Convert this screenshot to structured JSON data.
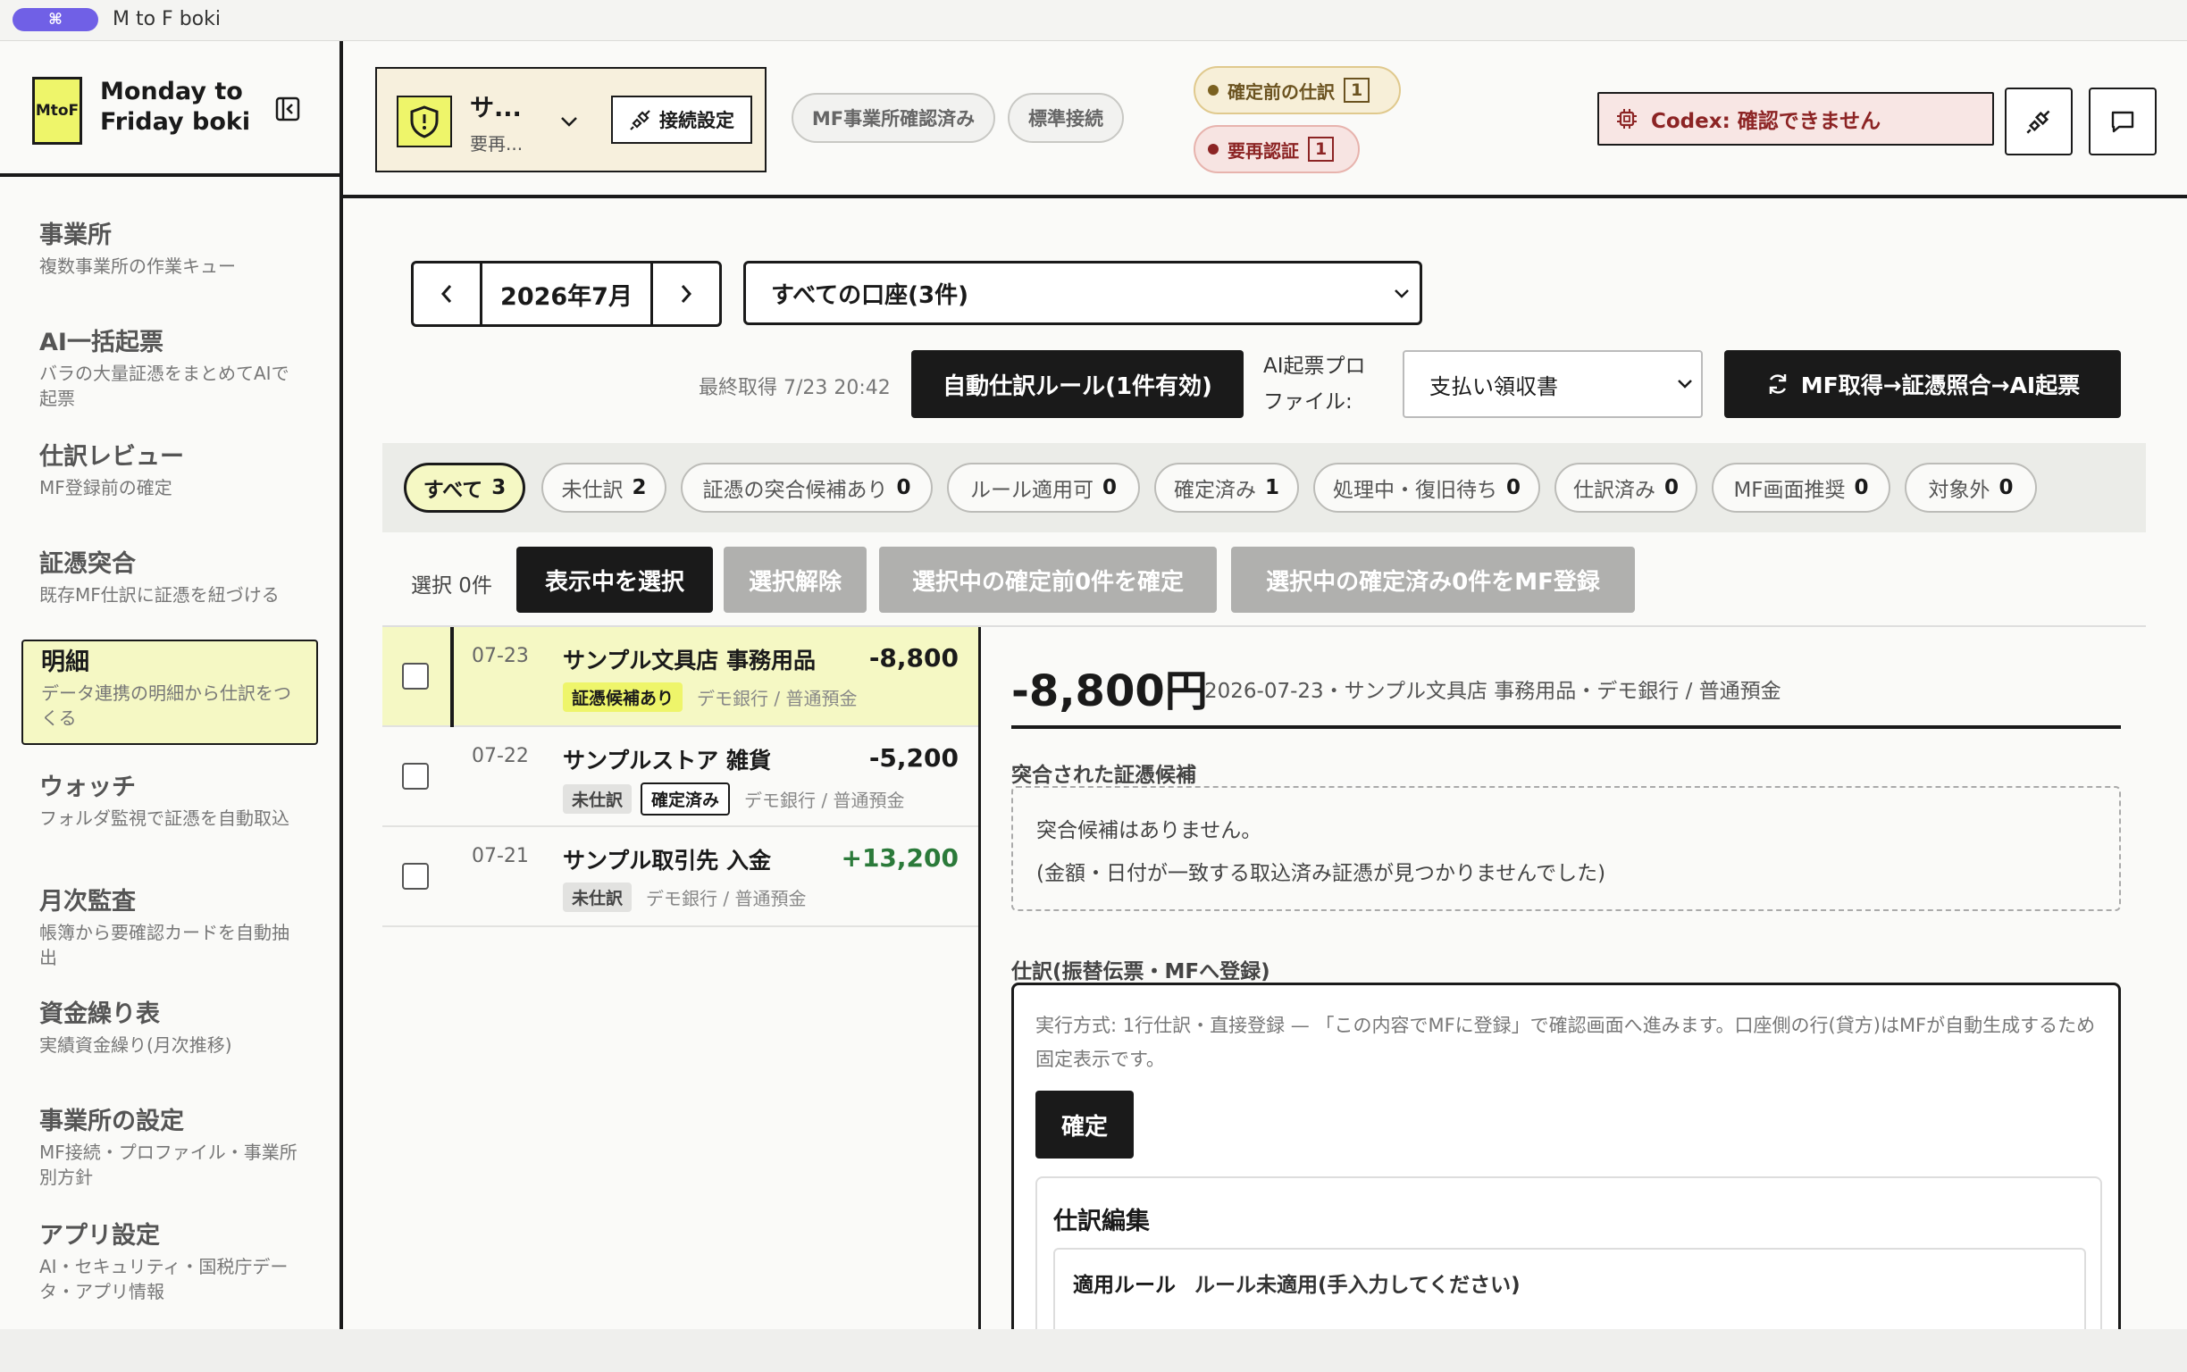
{
  "titlebar": {
    "shortcut_icon": "⌘",
    "app_title": "M to F boki"
  },
  "brand": {
    "logo": "MtoF",
    "name": "Monday to Friday boki"
  },
  "sidebar": {
    "items": [
      {
        "title": "事業所",
        "desc": "複数事業所の作業キュー"
      },
      {
        "title": "AI一括起票",
        "desc": "バラの大量証憑をまとめてAIで起票"
      },
      {
        "title": "仕訳レビュー",
        "desc": "MF登録前の確定"
      },
      {
        "title": "証憑突合",
        "desc": "既存MF仕訳に証憑を紐づける"
      },
      {
        "title": "明細",
        "desc": "データ連携の明細から仕訳をつくる"
      },
      {
        "title": "ウォッチ",
        "desc": "フォルダ監視で証憑を自動取込"
      },
      {
        "title": "月次監査",
        "desc": "帳簿から要確認カードを自動抽出"
      },
      {
        "title": "資金繰り表",
        "desc": "実績資金繰り(月次推移)"
      },
      {
        "title": "事業所の設定",
        "desc": "MF接続・プロファイル・事業所別方針"
      },
      {
        "title": "アプリ設定",
        "desc": "AI・セキュリティ・国税庁データ・アプリ情報"
      }
    ],
    "active_index": 4
  },
  "header": {
    "office_name": "サ...",
    "office_status": "要再...",
    "connect_label": "接続設定",
    "pill_confirmed": "MF事業所確認済み",
    "pill_standard": "標準接続",
    "badge_unconfirmed_label": "確定前の仕訳",
    "badge_unconfirmed_count": "1",
    "badge_reauth_label": "要再認証",
    "badge_reauth_count": "1",
    "codex_status": "Codex: 確認できません"
  },
  "toolbar": {
    "month": "2026年7月",
    "account_filter": "すべての口座(3件)",
    "last_fetch": "最終取得 7/23 20:42",
    "auto_rule_btn": "自動仕訳ルール(1件有効)",
    "ai_profile_label_1": "AI起票プロ",
    "ai_profile_label_2": "ファイル:",
    "ai_profile_value": "支払い領収書",
    "mf_fetch_btn": "MF取得→証憑照合→AI起票"
  },
  "filters": [
    {
      "label": "すべて",
      "count": "3"
    },
    {
      "label": "未仕訳",
      "count": "2"
    },
    {
      "label": "証憑の突合候補あり",
      "count": "0"
    },
    {
      "label": "ルール適用可",
      "count": "0"
    },
    {
      "label": "確定済み",
      "count": "1"
    },
    {
      "label": "処理中・復旧待ち",
      "count": "0"
    },
    {
      "label": "仕訳済み",
      "count": "0"
    },
    {
      "label": "MF画面推奨",
      "count": "0"
    },
    {
      "label": "対象外",
      "count": "0"
    }
  ],
  "selection": {
    "count_label": "選択 0件",
    "select_visible": "表示中を選択",
    "clear": "選択解除",
    "confirm_pending": "選択中の確定前0件を確定",
    "register_confirmed": "選択中の確定済み0件をMF登録"
  },
  "transactions": [
    {
      "date": "07-23",
      "name": "サンプル文具店 事務用品",
      "amount": "-8,800",
      "tags": [
        "証憑候補あり"
      ],
      "account": "デモ銀行 / 普通預金"
    },
    {
      "date": "07-22",
      "name": "サンプルストア 雑貨",
      "amount": "-5,200",
      "tags": [
        "未仕訳",
        "確定済み"
      ],
      "account": "デモ銀行 / 普通預金"
    },
    {
      "date": "07-21",
      "name": "サンプル取引先 入金",
      "amount": "+13,200",
      "tags": [
        "未仕訳"
      ],
      "account": "デモ銀行 / 普通預金"
    }
  ],
  "detail": {
    "amount": "-8,800円",
    "meta": "2026-07-23・サンプル文具店 事務用品・デモ銀行 / 普通預金",
    "cand_title": "突合された証憑候補",
    "cand_line1": "突合候補はありません。",
    "cand_line2": "(金額・日付が一致する取込済み証憑が見つかりませんでした)",
    "journal_title": "仕訳(振替伝票・MFへ登録)",
    "journal_note": "実行方式: 1行仕訳・直接登録 — 「この内容でMFに登録」で確認画面へ進みます。口座側の行(貸方)はMFが自動生成するため固定表示です。",
    "confirm_btn": "確定",
    "edit_title": "仕訳編集",
    "rule_key": "適用ルール",
    "rule_value": "ルール未適用(手入力してください)"
  }
}
